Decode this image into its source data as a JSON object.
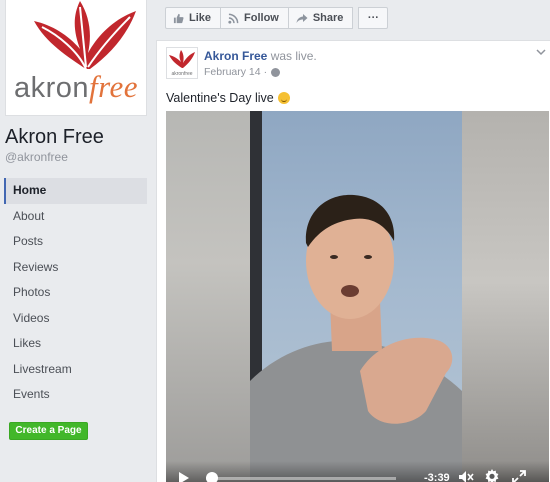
{
  "page": {
    "logo": {
      "text_grey": "akron",
      "text_orange": "free"
    },
    "name": "Akron Free",
    "handle": "@akronfree"
  },
  "nav": {
    "items": [
      {
        "label": "Home",
        "active": true
      },
      {
        "label": "About"
      },
      {
        "label": "Posts"
      },
      {
        "label": "Reviews"
      },
      {
        "label": "Photos"
      },
      {
        "label": "Videos"
      },
      {
        "label": "Likes"
      },
      {
        "label": "Livestream"
      },
      {
        "label": "Events"
      }
    ],
    "create_page_label": "Create a Page"
  },
  "actions": {
    "like_label": "Like",
    "follow_label": "Follow",
    "share_label": "Share",
    "more_label": "···"
  },
  "post": {
    "author": "Akron Free",
    "verb": "was live.",
    "date": "February 14",
    "separator": "·",
    "text": "Valentine's Day live"
  },
  "video": {
    "time_remaining": "-3:39",
    "progress": 0.03
  },
  "colors": {
    "link": "#365899",
    "brand_red": "#c1272d",
    "brand_orange": "#e2733b",
    "create_green": "#42b72a",
    "active_nav_border": "#4267b2"
  }
}
